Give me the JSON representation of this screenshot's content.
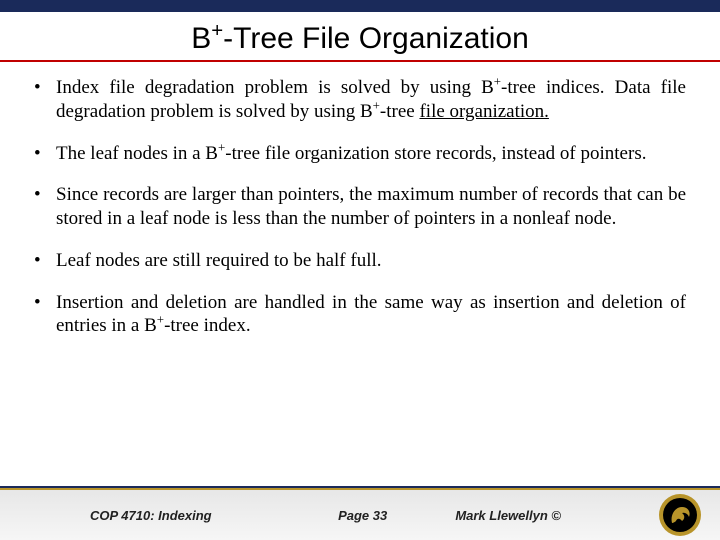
{
  "title_html": "B<sup>+</sup>-Tree File Organization",
  "bullets": [
    "Index file degradation problem is solved by using B<sup>+</sup>-tree indices. Data file degradation problem is solved by using B<sup>+</sup>-tree <span class=\"underline\">file organization.</span>",
    "The leaf nodes in a B<sup>+</sup>-tree file organization store records, instead of pointers.",
    "Since records are larger than pointers, the maximum number of records that can be stored in a leaf node is less than the number of pointers in a nonleaf node.",
    "Leaf nodes are still required to be half full.",
    "Insertion and deletion are handled in the same way as insertion and deletion of entries in a B<sup>+</sup>-tree index."
  ],
  "footer": {
    "course": "COP 4710: Indexing",
    "page": "Page 33",
    "author": "Mark Llewellyn ©"
  }
}
